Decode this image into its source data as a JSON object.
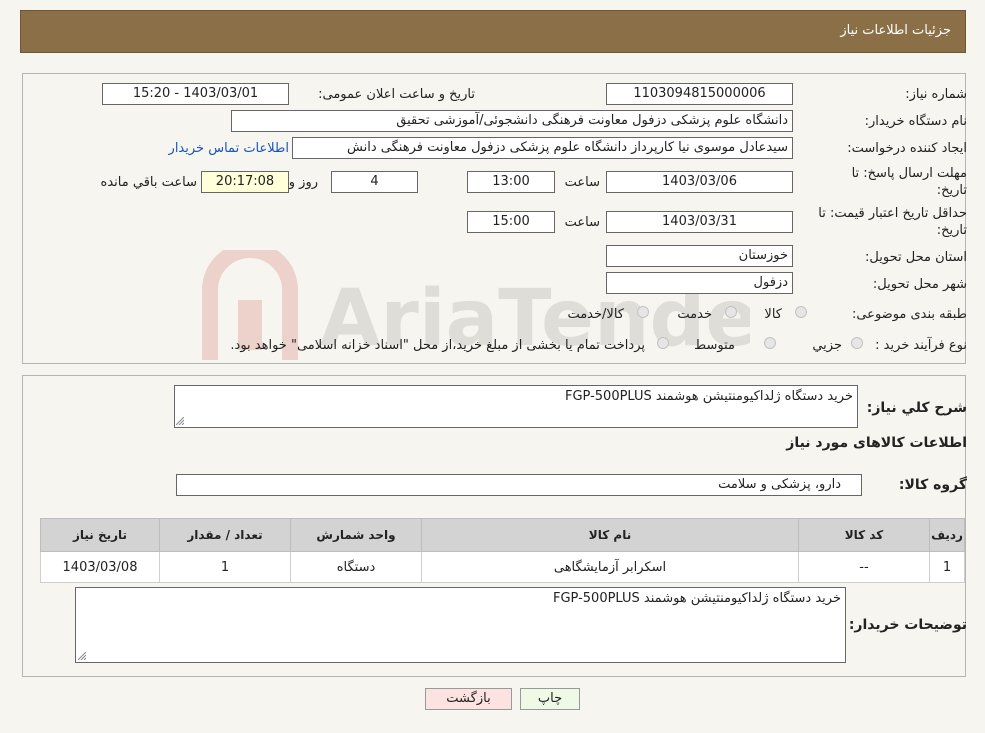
{
  "header": {
    "title": "جزئیات اطلاعات نیاز"
  },
  "watermark": {
    "text": "AriaTender.neT"
  },
  "form": {
    "need_number_label": "شماره نیاز:",
    "need_number": "1103094815000006",
    "announce_label": "تاریخ و ساعت اعلان عمومی:",
    "announce_value": "1403/03/01 - 15:20",
    "buyer_label": "نام دستگاه خریدار:",
    "buyer_value": "دانشگاه علوم پزشکی دزفول معاونت فرهنگی دانشجوئی/آموزشی تحقیق",
    "creator_label": "ایجاد کننده درخواست:",
    "creator_value": "سیدعادل موسوی نیا کارپرداز دانشگاه علوم پزشکی دزفول معاونت فرهنگی دانش",
    "contact_link": "اطلاعات تماس خریدار",
    "deadline_label": "مهلت ارسال پاسخ: تا",
    "deadline_label2": "تاریخ:",
    "deadline_date": "1403/03/06",
    "time_label": "ساعت",
    "deadline_time": "13:00",
    "days_value": "4",
    "days_label": "روز و",
    "remaining_time": "20:17:08",
    "remaining_label": "ساعت باقي مانده",
    "validity_label": "حداقل تاریخ اعتبار قیمت: تا",
    "validity_label2": "تاریخ:",
    "validity_date": "1403/03/31",
    "validity_time": "15:00",
    "province_label": "استان محل تحویل:",
    "province_value": "خوزستان",
    "city_label": "شهر محل تحویل:",
    "city_value": "دزفول",
    "category_label": "طبقه بندی موضوعی:",
    "category_options": [
      "کالا",
      "خدمت",
      "کالا/خدمت"
    ],
    "process_label": "نوع فرآیند خرید :",
    "process_options": [
      "جزیي",
      "متوسط"
    ],
    "process_note": "پرداخت تمام یا بخشی از مبلغ خرید،از محل \"اسناد خزانه اسلامی\" خواهد بود."
  },
  "details": {
    "summary_label": "شرح كلي نياز:",
    "summary_value": "خرید دستگاه ژلداکیومنتیشن هوشمند FGP-500PLUS",
    "items_title": "اطلاعات کالاهای مورد نیاز",
    "group_label": "گروه کالا:",
    "group_value": "دارو، پزشکی و سلامت",
    "table": {
      "headers": [
        "ردیف",
        "کد کالا",
        "نام کالا",
        "واحد شمارش",
        "تعداد / مقدار",
        "تاریخ نیاز"
      ],
      "rows": [
        [
          "1",
          "--",
          "اسکرابر آزمایشگاهی",
          "دستگاه",
          "1",
          "1403/03/08"
        ]
      ]
    },
    "buyer_notes_label": "توضیحات خریدار:",
    "buyer_notes_value": "خرید دستگاه ژلداکیومنتیشن هوشمند FGP-500PLUS"
  },
  "buttons": {
    "print": "چاپ",
    "back": "بازگشت"
  }
}
